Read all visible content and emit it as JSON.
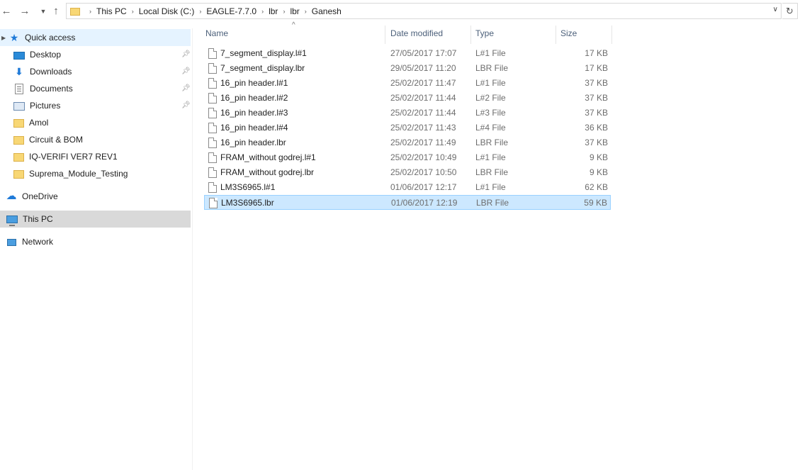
{
  "address_bar": {
    "crumbs": [
      "This PC",
      "Local Disk (C:)",
      "EAGLE-7.7.0",
      "lbr",
      "lbr",
      "Ganesh"
    ]
  },
  "sidebar": {
    "quick_access": "Quick access",
    "items": [
      {
        "label": "Desktop",
        "icon": "desktop-icon",
        "pinned": true
      },
      {
        "label": "Downloads",
        "icon": "download-icon",
        "pinned": true
      },
      {
        "label": "Documents",
        "icon": "documents-icon",
        "pinned": true
      },
      {
        "label": "Pictures",
        "icon": "pictures-icon",
        "pinned": true
      },
      {
        "label": "Amol",
        "icon": "folder-icon",
        "pinned": false
      },
      {
        "label": "Circuit & BOM",
        "icon": "folder-icon",
        "pinned": false
      },
      {
        "label": "IQ-VERIFI VER7 REV1",
        "icon": "folder-icon",
        "pinned": false
      },
      {
        "label": "Suprema_Module_Testing",
        "icon": "folder-icon",
        "pinned": false
      }
    ],
    "onedrive": "OneDrive",
    "this_pc": "This PC",
    "network": "Network"
  },
  "columns": {
    "name": "Name",
    "date_modified": "Date modified",
    "type": "Type",
    "size": "Size"
  },
  "files": [
    {
      "name": "7_segment_display.l#1",
      "date": "27/05/2017 17:07",
      "type": "L#1 File",
      "size": "17 KB"
    },
    {
      "name": "7_segment_display.lbr",
      "date": "29/05/2017 11:20",
      "type": "LBR File",
      "size": "17 KB"
    },
    {
      "name": "16_pin header.l#1",
      "date": "25/02/2017 11:47",
      "type": "L#1 File",
      "size": "37 KB"
    },
    {
      "name": "16_pin header.l#2",
      "date": "25/02/2017 11:44",
      "type": "L#2 File",
      "size": "37 KB"
    },
    {
      "name": "16_pin header.l#3",
      "date": "25/02/2017 11:44",
      "type": "L#3 File",
      "size": "37 KB"
    },
    {
      "name": "16_pin header.l#4",
      "date": "25/02/2017 11:43",
      "type": "L#4 File",
      "size": "36 KB"
    },
    {
      "name": "16_pin header.lbr",
      "date": "25/02/2017 11:49",
      "type": "LBR File",
      "size": "37 KB"
    },
    {
      "name": "FRAM_without godrej.l#1",
      "date": "25/02/2017 10:49",
      "type": "L#1 File",
      "size": "9 KB"
    },
    {
      "name": "FRAM_without godrej.lbr",
      "date": "25/02/2017 10:50",
      "type": "LBR File",
      "size": "9 KB"
    },
    {
      "name": "LM3S6965.l#1",
      "date": "01/06/2017 12:17",
      "type": "L#1 File",
      "size": "62 KB"
    },
    {
      "name": "LM3S6965.lbr",
      "date": "01/06/2017 12:19",
      "type": "LBR File",
      "size": "59 KB",
      "selected": true
    }
  ],
  "colors": {
    "selection_bg": "#cce8ff",
    "selection_border": "#99d1ff",
    "nav_selected_bg": "#d9d9d9",
    "quick_access_bg": "#e5f3ff",
    "accent": "#1f7ad8"
  }
}
